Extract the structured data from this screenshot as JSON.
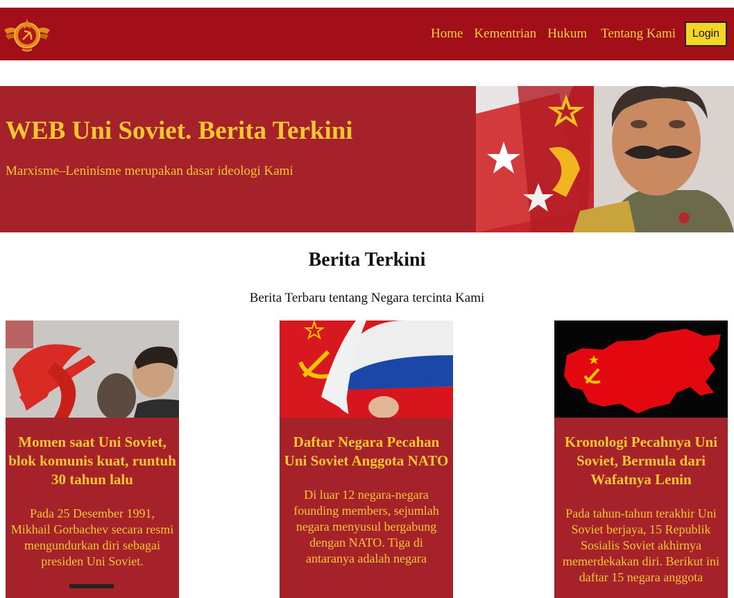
{
  "nav": {
    "items": [
      "Home",
      "Kementrian",
      "Hukum",
      "Tentang Kami"
    ],
    "login_label": "Login"
  },
  "hero": {
    "title": "WEB Uni Soviet. Berita Terkini",
    "subtitle": "Marxisme–Leninisme merupakan dasar ideologi Kami"
  },
  "news": {
    "title": "Berita Terkini",
    "subtitle": "Berita Terbaru tentang Negara tercinta Kami",
    "cards": [
      {
        "title": "Momen saat Uni Soviet, blok komunis kuat, runtuh 30 tahun lalu",
        "text": "Pada 25 Desember 1991, Mikhail Gorbachev secara resmi mengundurkan diri sebagai presiden Uni Soviet."
      },
      {
        "title": "Daftar Negara Pecahan Uni Soviet Anggota NATO",
        "text": "Di luar 12 negara-negara founding members, sejumlah negara menyusul bergabung dengan NATO. Tiga di antaranya adalah negara"
      },
      {
        "title": "Kronologi Pecahnya Uni Soviet, Bermula dari Wafatnya Lenin",
        "text": "Pada tahun-tahun terakhir Uni Soviet berjaya, 15 Republik Sosialis Soviet akhirnya memerdekakan diri. Berikut ini daftar 15 negara anggota"
      }
    ]
  },
  "colors": {
    "navbar": "#a20f18",
    "hero": "#a5222a",
    "accent_text": "#f5c831",
    "login_button": "#f5d623"
  }
}
